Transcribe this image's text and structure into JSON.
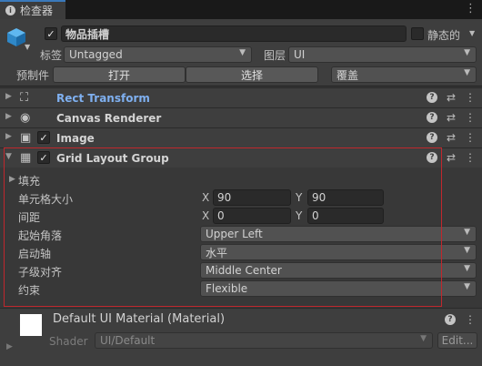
{
  "tab": {
    "title": "检查器"
  },
  "header": {
    "object_name": "物品插槽",
    "static_label": "静态的",
    "tag_label": "标签",
    "tag_value": "Untagged",
    "layer_label": "图层",
    "layer_value": "UI",
    "prefab_label": "预制件",
    "open_label": "打开",
    "select_label": "选择",
    "override_label": "覆盖"
  },
  "components": [
    {
      "name": "Rect Transform",
      "color": "#7fb0f0"
    },
    {
      "name": "Canvas Renderer"
    },
    {
      "name": "Image"
    },
    {
      "name": "Grid Layout Group"
    }
  ],
  "grid": {
    "padding_label": "填充",
    "cell_size_label": "单元格大小",
    "cell_x": "90",
    "cell_y": "90",
    "spacing_label": "间距",
    "spacing_x": "0",
    "spacing_y": "0",
    "x_label": "X",
    "y_label": "Y",
    "start_corner_label": "起始角落",
    "start_corner_value": "Upper Left",
    "start_axis_label": "启动轴",
    "start_axis_value": "水平",
    "child_align_label": "子级对齐",
    "child_align_value": "Middle Center",
    "constraint_label": "约束",
    "constraint_value": "Flexible"
  },
  "material": {
    "name": "Default UI Material (Material)",
    "shader_label": "Shader",
    "shader_value": "UI/Default",
    "edit_label": "Edit..."
  },
  "icons": {
    "tab": "info-icon",
    "gameobject": "cube-icon",
    "rect": "rect-transform-icon",
    "canvas": "eye-icon",
    "image": "image-icon",
    "grid": "grid-icon",
    "help": "help-icon",
    "presets": "sliders-icon",
    "menu": "kebab-icon"
  },
  "colors": {
    "accent": "#3a79bb",
    "highlight_box": "#c0272d"
  }
}
